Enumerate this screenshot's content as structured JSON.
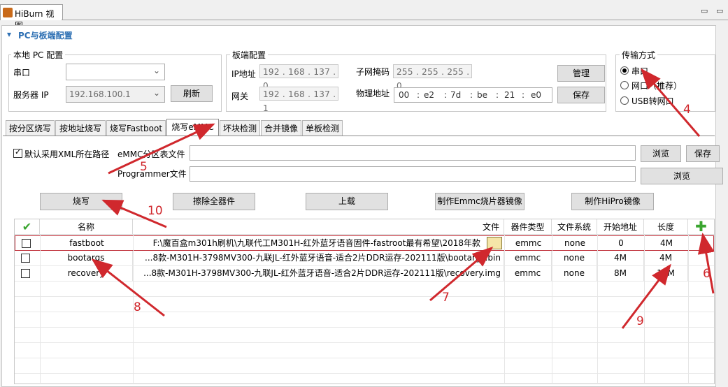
{
  "window": {
    "tab_title": "HiBurn 视图",
    "min_btn": "▭",
    "max_btn": "▭"
  },
  "pc_section": {
    "title": "PC与板端配置",
    "local": {
      "group_label": "本地 PC 配置",
      "serial_label": "串口",
      "serial_value": "",
      "server_ip_label": "服务器 IP",
      "server_ip_value": "192.168.100.1",
      "refresh_btn": "刷新"
    },
    "board": {
      "group_label": "板端配置",
      "ip_label": "IP地址",
      "ip": [
        "192",
        "168",
        "137",
        "0"
      ],
      "mask_label": "子网掩码",
      "mask": [
        "255",
        "255",
        "255",
        "0"
      ],
      "gateway_label": "网关",
      "gateway": [
        "192",
        "168",
        "137",
        "1"
      ],
      "mac_label": "物理地址",
      "mac": [
        "00",
        "e2",
        "7d",
        "be",
        "21",
        "e0"
      ],
      "manage_btn": "管理",
      "save_btn": "保存"
    },
    "transfer": {
      "group_label": "传输方式",
      "options": [
        "串口",
        "网口（推荐）",
        "USB转网口"
      ],
      "selected": 0
    }
  },
  "tabs": [
    "按分区烧写",
    "按地址烧写",
    "烧写Fastboot",
    "烧写eMMC",
    "坏块检测",
    "合并镜像",
    "单板检测"
  ],
  "active_tab": 3,
  "emmc": {
    "use_xml_label": "默认采用XML所在路径",
    "partition_label": "eMMC分区表文件",
    "partition_value": "",
    "browse1": "浏览",
    "save": "保存",
    "programmer_label": "Programmer文件",
    "programmer_value": "",
    "browse2": "浏览",
    "actions": [
      "烧写",
      "擦除全器件",
      "上载",
      "制作Emmc烧片器镜像",
      "制作HiPro镜像"
    ]
  },
  "table": {
    "headers": [
      "名称",
      "文件",
      "器件类型",
      "文件系统",
      "开始地址",
      "长度"
    ],
    "add_icon": "plus-icon",
    "rows": [
      {
        "name": "fastboot",
        "file": "F:\\魔百盒m301h刷机\\九联代工M301H-红外蓝牙语音固件-fastroot最有希望\\2018年款",
        "device": "emmc",
        "fs": "none",
        "start": "0",
        "length": "4M"
      },
      {
        "name": "bootargs",
        "file": "...8款-M301H-3798MV300-九联JL-红外蓝牙语音-适合2片DDR运存-202111版\\bootargs.bin",
        "device": "emmc",
        "fs": "none",
        "start": "4M",
        "length": "4M"
      },
      {
        "name": "recovery",
        "file": "...8款-M301H-3798MV300-九联JL-红外蓝牙语音-适合2片DDR运存-202111版\\recovery.img",
        "device": "emmc",
        "fs": "none",
        "start": "8M",
        "length": "12M"
      }
    ]
  },
  "annotations": [
    "4",
    "5",
    "6",
    "7",
    "8",
    "9",
    "10"
  ],
  "colors": {
    "accent": "#2d6fb3",
    "annotation": "#d0282d",
    "add_icon": "#3aa52f"
  }
}
